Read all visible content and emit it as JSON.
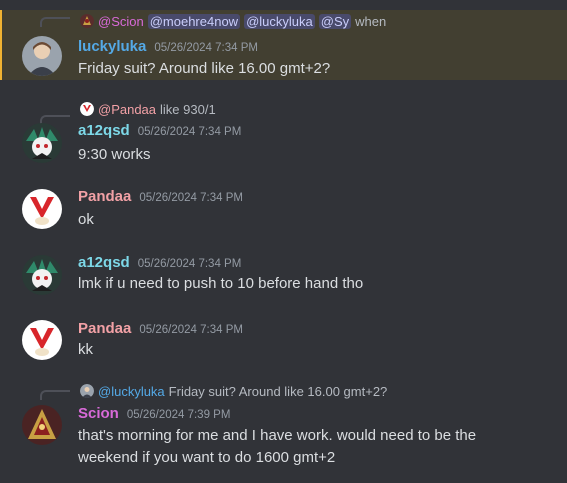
{
  "colors": {
    "background": "#313338",
    "highlight_bg": "#423f31",
    "highlight_bar": "#f0b232",
    "user_luckyluka": "#54a9e6",
    "user_a12qsd": "#7dd8e8",
    "user_pandaa": "#f2a1a6",
    "user_scion": "#d86ad8"
  },
  "messages": [
    {
      "reply": {
        "author": "@Scion",
        "mentions": [
          "@moehre4now",
          "@luckyluka",
          "@Sy"
        ],
        "text": "when"
      },
      "author": "luckyluka",
      "timestamp": "05/26/2024 7:34 PM",
      "text": "Friday suit? Around like 16.00 gmt+2?",
      "avatar_icon": "person-avatar-icon",
      "highlighted": true
    },
    {
      "reply": {
        "author": "@Pandaa",
        "text": "like 930/1"
      },
      "author": "a12qsd",
      "timestamp": "05/26/2024 7:34 PM",
      "text": "9:30 works",
      "avatar_icon": "anime-character-avatar-icon"
    },
    {
      "author": "Pandaa",
      "timestamp": "05/26/2024 7:34 PM",
      "text": "ok",
      "avatar_icon": "panda-v-logo-avatar-icon"
    },
    {
      "author": "a12qsd",
      "timestamp": "05/26/2024 7:34 PM",
      "text": "lmk if u need to push to 10 before hand tho",
      "avatar_icon": "anime-character-avatar-icon"
    },
    {
      "author": "Pandaa",
      "timestamp": "05/26/2024 7:34 PM",
      "text": "kk",
      "avatar_icon": "panda-v-logo-avatar-icon"
    },
    {
      "reply": {
        "author": "@luckyluka",
        "text": "Friday suit? Around like 16.00 gmt+2?"
      },
      "author": "Scion",
      "timestamp": "05/26/2024 7:39 PM",
      "text": "that's morning for me and I have work. would need to be the weekend if you want to do 1600 gmt+2",
      "avatar_icon": "dragon-avatar-icon"
    }
  ]
}
